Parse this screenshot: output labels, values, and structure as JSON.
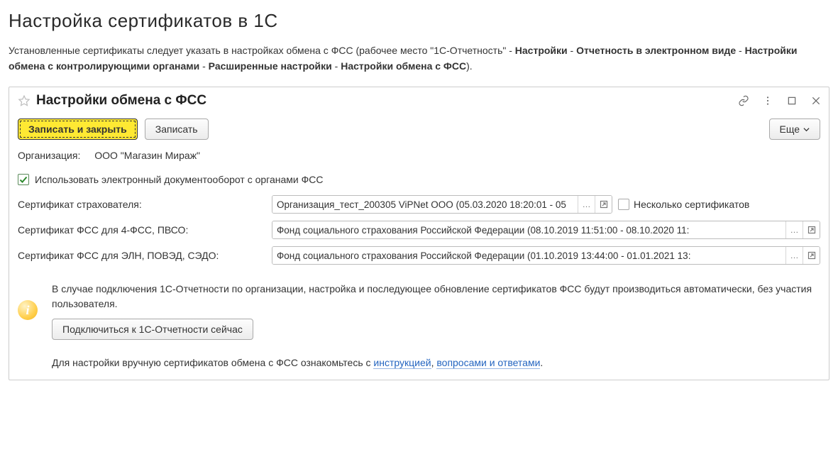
{
  "page": {
    "heading": "Настройка сертификатов в 1С"
  },
  "breadcrumb": {
    "intro": "Установленные сертификаты следует указать в настройках обмена с ФСС (рабочее место \"1С-Отчетность\" - ",
    "p1": "Настройки",
    "sep": " - ",
    "p2": "Отчетность в электронном виде",
    "p3": "Настройки обмена с контролирующими органами",
    "p4": "Расширенные настройки",
    "p5": "Настройки обмена с ФСС",
    "end": ")."
  },
  "window": {
    "title": "Настройки обмена с ФСС"
  },
  "toolbar": {
    "save_close": "Записать и закрыть",
    "save": "Записать",
    "more": "Еще"
  },
  "form": {
    "org_label": "Организация:",
    "org_value": "ООО \"Магазин Мираж\"",
    "edo_checkbox": "Использовать электронный документооборот с органами ФСС",
    "cert_insurer": {
      "label": "Сертификат страхователя:",
      "value": "Организация_тест_200305 ViPNet ООО (05.03.2020 18:20:01 - 05"
    },
    "multi_cert": "Несколько сертификатов",
    "cert_4fss": {
      "label": "Сертификат ФСС для 4-ФСС, ПВСО:",
      "value": "Фонд социального страхования Российской Федерации (08.10.2019 11:51:00 - 08.10.2020 11:"
    },
    "cert_eln": {
      "label": "Сертификат ФСС для ЭЛН, ПОВЭД, СЭДО:",
      "value": "Фонд социального страхования Российской Федерации (01.10.2019 13:44:00 - 01.01.2021 13:"
    },
    "info_text": "В случае подключения 1С-Отчетности по организации, настройка и последующее обновление сертификатов ФСС будут производиться автоматически, без участия пользователя.",
    "connect_btn": "Подключиться к 1С-Отчетности сейчас",
    "footer_pre": "Для настройки вручную сертификатов обмена с ФСС ознакомьтесь с ",
    "footer_link1": "инструкцией",
    "footer_mid": ", ",
    "footer_link2": "вопросами и ответами",
    "footer_end": "."
  }
}
